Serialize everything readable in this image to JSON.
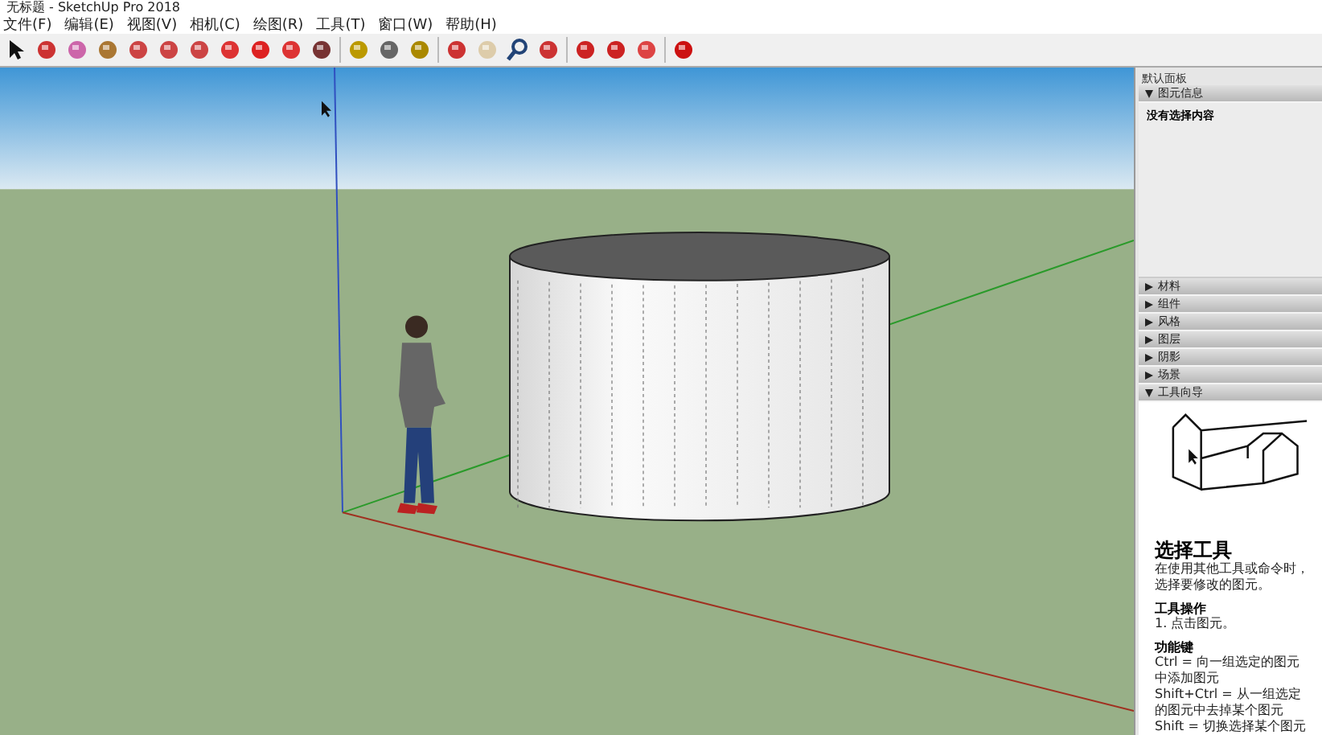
{
  "window": {
    "title": "无标题 - SketchUp Pro 2018"
  },
  "menu": [
    "文件(F)",
    "编辑(E)",
    "视图(V)",
    "相机(C)",
    "绘图(R)",
    "工具(T)",
    "窗口(W)",
    "帮助(H)"
  ],
  "tray": {
    "title": "默认面板",
    "sections": [
      {
        "label": "图元信息",
        "expanded": true,
        "kind": "info",
        "text": "没有选择内容"
      },
      {
        "label": "材料",
        "expanded": false
      },
      {
        "label": "组件",
        "expanded": false
      },
      {
        "label": "风格",
        "expanded": false
      },
      {
        "label": "图层",
        "expanded": false
      },
      {
        "label": "阴影",
        "expanded": false
      },
      {
        "label": "场景",
        "expanded": false
      },
      {
        "label": "工具向导",
        "expanded": true,
        "kind": "guide",
        "heading": "选择工具",
        "description": "在使用其他工具或命令时，选择要修改的图元。",
        "groups": [
          {
            "title": "工具操作",
            "lines": [
              "1. 点击图元。"
            ]
          },
          {
            "title": "功能键",
            "lines": [
              "Ctrl = 向一组选定的图元中添加图元",
              "Shift+Ctrl = 从一组选定的图元中去掉某个图元",
              "Shift = 切换选择某个图元"
            ]
          }
        ]
      }
    ]
  }
}
